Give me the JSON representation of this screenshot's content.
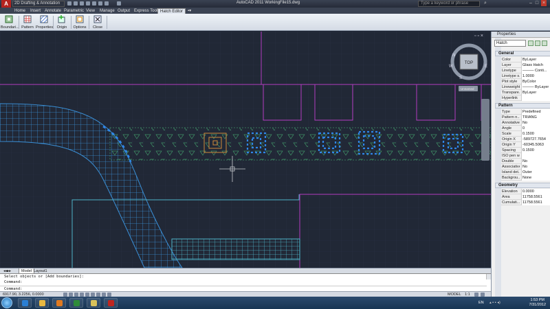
{
  "app": {
    "title": "AutoCAD 2011   WorkingFile15.dwg",
    "logo": "A",
    "workspace": "2D Drafting & Annotation",
    "search_placeholder": "Type a keyword or phrase"
  },
  "menu_tabs": [
    "Home",
    "Insert",
    "Annotate",
    "Parametric",
    "View",
    "Manage",
    "Output",
    "Express Tools",
    "Hatch Editor"
  ],
  "ribbon": {
    "buttons": [
      {
        "label": "Boundari...",
        "icon": "boundaries-icon"
      },
      {
        "label": "Pattern",
        "icon": "pattern-icon"
      },
      {
        "label": "Properties",
        "icon": "properties-icon"
      },
      {
        "label": "Origin",
        "icon": "origin-icon"
      },
      {
        "label": "Options",
        "icon": "options-icon"
      },
      {
        "label": "Close",
        "icon": "close-icon"
      }
    ]
  },
  "viewcube": {
    "label": "TOP",
    "north": "N",
    "south": "S",
    "east": "E",
    "west": "W",
    "ucs": "Unnamed"
  },
  "layout_tabs": [
    "Model",
    "Layout1"
  ],
  "command_lines": [
    "Select objects or [Add boundaries]:",
    "Command:",
    "",
    "Command:"
  ],
  "status": {
    "coords": "6917.90, 3.2256, 0.0000",
    "model": "MODEL",
    "scale": "1:1"
  },
  "properties": {
    "title": "Properties",
    "selection": "Hatch",
    "sections": [
      {
        "name": "General",
        "rows": [
          {
            "k": "Color",
            "v": "ByLayer"
          },
          {
            "k": "Layer",
            "v": "Glass Hatch"
          },
          {
            "k": "Linetype",
            "v": "——— Conti..."
          },
          {
            "k": "Linetype s...",
            "v": "1.0000"
          },
          {
            "k": "Plot style",
            "v": "ByColor"
          },
          {
            "k": "Lineweight",
            "v": "——— ByLayer"
          },
          {
            "k": "Transpare...",
            "v": "ByLayer"
          },
          {
            "k": "Hyperlink",
            "v": ""
          }
        ]
      },
      {
        "name": "Pattern",
        "rows": [
          {
            "k": "Type",
            "v": "Predefined"
          },
          {
            "k": "Pattern n...",
            "v": "TRIANG"
          },
          {
            "k": "Annotative",
            "v": "No"
          },
          {
            "k": "Angle",
            "v": "0"
          },
          {
            "k": "Scale",
            "v": "0.1500"
          },
          {
            "k": "Origin X",
            "v": "-589727.7654"
          },
          {
            "k": "Origin Y",
            "v": "-60345.5063"
          },
          {
            "k": "Spacing",
            "v": "0.1500"
          },
          {
            "k": "ISO pen w...",
            "v": ""
          },
          {
            "k": "Double",
            "v": "No"
          },
          {
            "k": "Associative",
            "v": "No"
          },
          {
            "k": "Island det...",
            "v": "Outer"
          },
          {
            "k": "Backgrou...",
            "v": "None"
          }
        ]
      },
      {
        "name": "Geometry",
        "rows": [
          {
            "k": "Elevation",
            "v": "0.0000"
          },
          {
            "k": "Area",
            "v": "11758.5561"
          },
          {
            "k": "Cumulati...",
            "v": "11758.5561"
          }
        ]
      }
    ]
  },
  "taskbar": {
    "lang": "EN",
    "time": "1:53 PM",
    "date": "7/31/2012",
    "apps": [
      {
        "icon": "ie-icon",
        "color": "#2a7fd4"
      },
      {
        "icon": "folder-icon",
        "color": "#e8b840"
      },
      {
        "icon": "media-icon",
        "color": "#e07a20"
      },
      {
        "icon": "excel-icon",
        "color": "#2e8b3a"
      },
      {
        "icon": "explorer-icon",
        "color": "#d9c25a"
      },
      {
        "icon": "autocad-icon",
        "color": "#c0261f"
      }
    ]
  },
  "colors": {
    "canvas": "#212836",
    "grid": "#2a3244",
    "magenta": "#b43cc0",
    "cyan": "#4fb3c8",
    "hatch_blue": "#3a8fd6",
    "grip_blue": "#2f86e8",
    "hatch_green": "#3f8f66",
    "orange": "#d08a3a"
  }
}
